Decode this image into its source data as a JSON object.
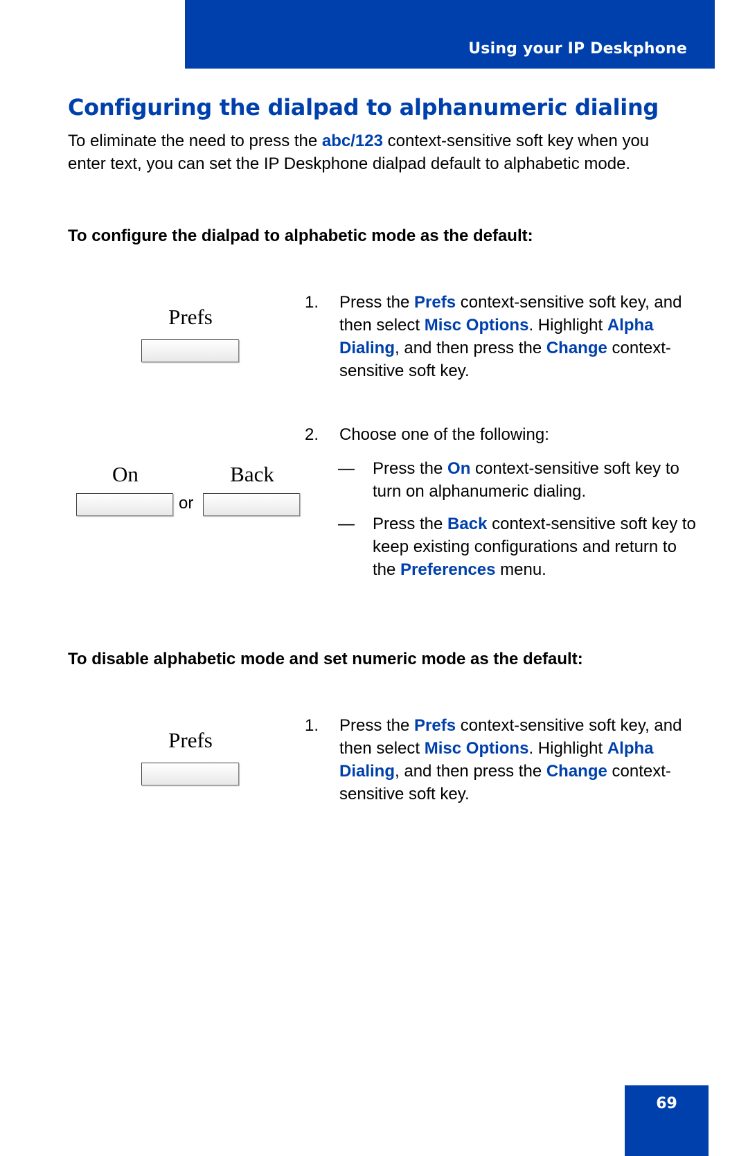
{
  "header": {
    "section_title": "Using your IP Deskphone"
  },
  "page": {
    "title": "Configuring the dialpad to alphanumeric dialing",
    "intro": {
      "before": "To eliminate the need to press the ",
      "highlight": "abc/123",
      "after": " context-sensitive soft key when you enter text, you can set the IP Deskphone dialpad default to alphabetic mode."
    },
    "procedure1": {
      "heading": "To configure the dialpad to alphabetic mode as the default:",
      "softkey_prefs": "Prefs",
      "softkey_on": "On",
      "softkey_back": "Back",
      "or_label": "or",
      "step1": {
        "num": "1.",
        "t1": "Press the ",
        "h1": "Prefs",
        "t2": " context-sensitive soft key, and then select ",
        "h2": "Misc Options",
        "t3": ". Highlight ",
        "h3": "Alpha Dialing",
        "t4": ", and then press the ",
        "h4": "Change",
        "t5": " context-sensitive soft key."
      },
      "step2": {
        "num": "2.",
        "text": "Choose one of the following:",
        "options": [
          {
            "dash": "—",
            "t1": "Press the ",
            "h1": "On",
            "t2": " context-sensitive soft key to turn on alphanumeric dialing."
          },
          {
            "dash": "—",
            "t1": "Press the ",
            "h1": "Back",
            "t2": " context-sensitive soft key to keep existing configurations and return to the ",
            "h2": "Preferences",
            "t3": " menu."
          }
        ]
      }
    },
    "procedure2": {
      "heading": "To disable alphabetic mode and set numeric mode as the default:",
      "softkey_prefs": "Prefs",
      "step1": {
        "num": "1.",
        "t1": "Press the ",
        "h1": "Prefs",
        "t2": " context-sensitive soft key, and then select ",
        "h2": "Misc Options",
        "t3": ". Highlight ",
        "h3": "Alpha Dialing",
        "t4": ", and then press the ",
        "h4": "Change",
        "t5": " context-sensitive soft key."
      }
    }
  },
  "footer": {
    "page_number": "69"
  },
  "colors": {
    "brand_blue": "#0040AC"
  }
}
